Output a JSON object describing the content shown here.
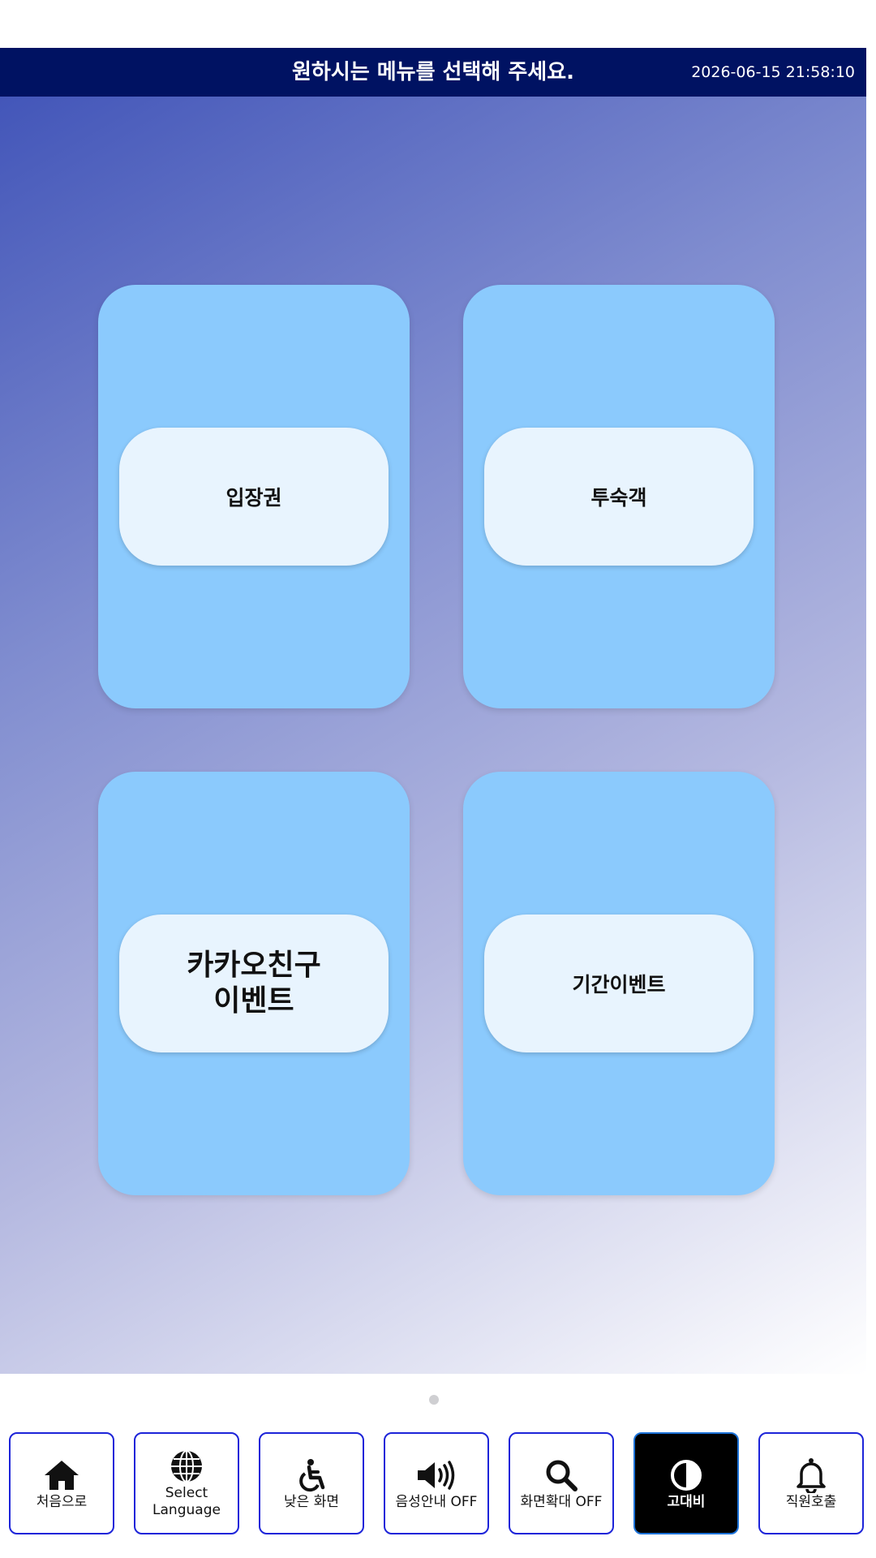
{
  "header": {
    "title": "원하시는 메뉴를 선택해 주세요.",
    "datetime": "2026-06-15 21:58:10"
  },
  "menu": {
    "items": [
      {
        "label": "입장권"
      },
      {
        "label": "투숙객"
      },
      {
        "label": "카카오친구\n이벤트"
      },
      {
        "label": "기간이벤트"
      }
    ]
  },
  "pager": {
    "current_page": 1,
    "total_pages": 1
  },
  "toolbar": {
    "items": [
      {
        "label": "처음으로",
        "icon": "home-icon"
      },
      {
        "label": "Select\nLanguage",
        "icon": "globe-icon"
      },
      {
        "label": "낮은 화면",
        "icon": "wheelchair-icon"
      },
      {
        "label": "음성안내 OFF",
        "icon": "speaker-icon"
      },
      {
        "label": "화면확대 OFF",
        "icon": "magnifier-icon"
      },
      {
        "label": "고대비",
        "icon": "contrast-icon",
        "active": true
      },
      {
        "label": "직원호출",
        "icon": "bell-icon"
      }
    ]
  },
  "colors": {
    "header_bg": "#001262",
    "card_bg": "#8bcafd",
    "card_label_bg": "#e8f4fe",
    "toolbar_border": "#1d24d9",
    "active_bg": "#000000"
  }
}
